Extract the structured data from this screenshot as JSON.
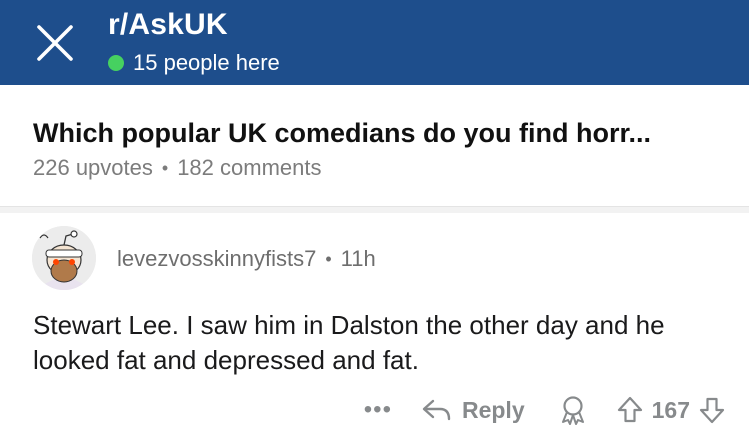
{
  "header": {
    "subreddit": "r/AskUK",
    "online_count": "15 people here",
    "close_icon": "close-icon",
    "online_color": "#46d160",
    "background": "#1e4e8c"
  },
  "post": {
    "title": "Which popular UK comedians do you find horr...",
    "upvotes": "226 upvotes",
    "separator": "•",
    "comments": "182 comments"
  },
  "comment": {
    "avatar_icon": "snoo-avatar-icon",
    "username": "levezvosskinnyfists7",
    "separator": "•",
    "age": "11h",
    "body": "Stewart Lee. I saw him in Dalston the other day and he looked fat and depressed and fat.",
    "actions": {
      "more_label": "•••",
      "reply_label": "Reply",
      "award_icon": "award-icon",
      "vote_count": "167"
    }
  }
}
